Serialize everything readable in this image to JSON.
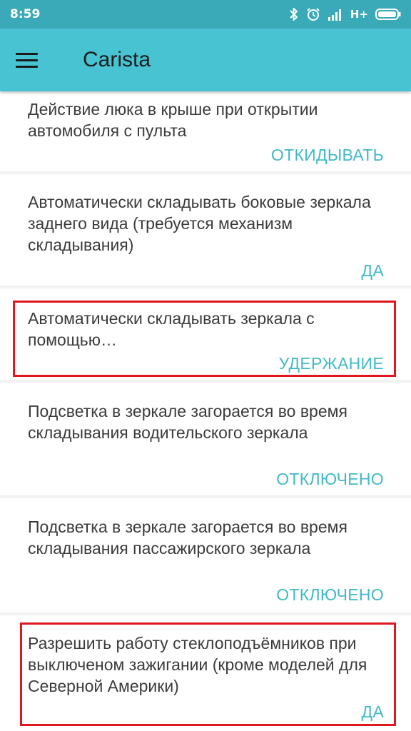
{
  "status_bar": {
    "time": "8:59",
    "network": "H+",
    "icons": [
      "bluetooth-icon",
      "alarm-icon",
      "signal-icon",
      "battery-icon"
    ]
  },
  "app_bar": {
    "title": "Carista",
    "menu_icon": "hamburger-menu-icon"
  },
  "settings": [
    {
      "label": "Действие люка в крыше при открытии автомобиля с пульта",
      "value": "ОТКИДЫВАТЬ"
    },
    {
      "label": "Автоматически складывать боковые зеркала заднего вида (требуется механизм складывания)",
      "value": "ДА"
    },
    {
      "label": "Автоматически складывать зеркала с помощью…",
      "value": "УДЕРЖАНИЕ"
    },
    {
      "label": "Подсветка в зеркале загорается во время складывания водительского зеркала",
      "value": "ОТКЛЮЧЕНО"
    },
    {
      "label": "Подсветка в зеркале загорается во время складывания пассажирского зеркала",
      "value": "ОТКЛЮЧЕНО"
    },
    {
      "label": "Разрешить работу стеклоподъёмников при выключеном зажигании (кроме моделей для Северной Америки)",
      "value": "ДА"
    }
  ],
  "colors": {
    "status_bar": "#3aa9b8",
    "app_bar": "#47c3d1",
    "accent_value": "#43b9c7",
    "highlight": "#e0171f",
    "background": "#f2f2f2"
  }
}
